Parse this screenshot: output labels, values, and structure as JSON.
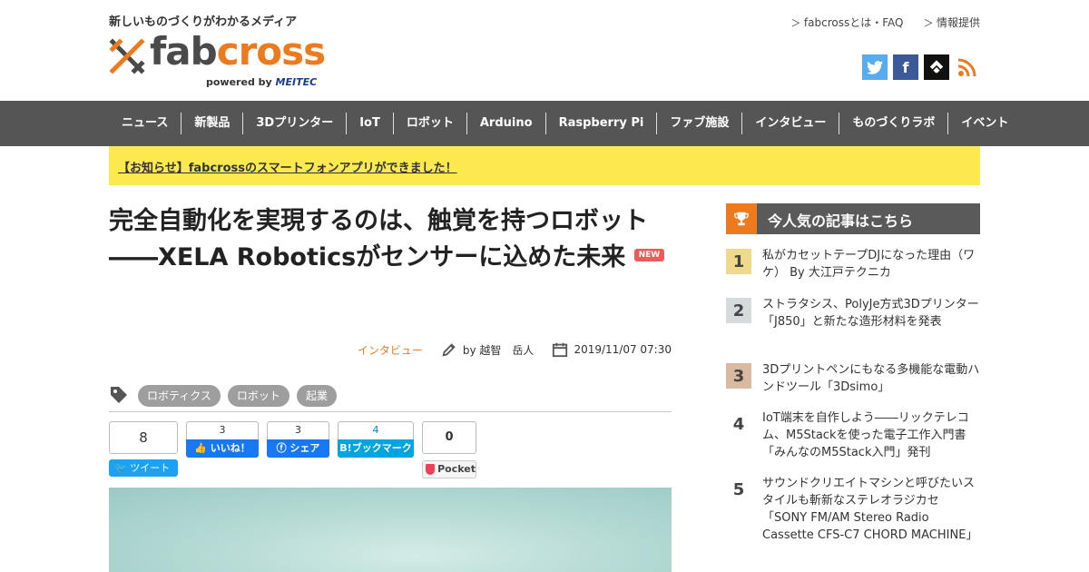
{
  "header": {
    "tagline": "新しいものづくりがわかるメディア",
    "logo": {
      "fab": "fab",
      "cross": "cross",
      "powered_by": "powered by",
      "meitec": "MEITEC"
    },
    "links": [
      "fabcrossとは・FAQ",
      "情報提供"
    ],
    "social": [
      {
        "name": "twitter-icon",
        "glyph": ""
      },
      {
        "name": "facebook-icon",
        "glyph": "f"
      },
      {
        "name": "feedly-icon",
        "glyph": ""
      },
      {
        "name": "rss-icon",
        "glyph": ""
      }
    ]
  },
  "nav": [
    "ニュース",
    "新製品",
    "3Dプリンター",
    "IoT",
    "ロボット",
    "Arduino",
    "Raspberry Pi",
    "ファブ施設",
    "インタビュー",
    "ものづくりラボ",
    "イベント"
  ],
  "notice": "【お知らせ】fabcrossのスマートフォンアプリができました！",
  "article": {
    "title": "完全自動化を実現するのは、触覚を持つロボット――XELA Roboticsがセンサーに込めた未来",
    "new_badge": "NEW",
    "category": "インタビュー",
    "author": "by 越智　岳人",
    "date": "2019/11/07 07:30",
    "tags": [
      "ロボティクス",
      "ロボット",
      "起業"
    ]
  },
  "share": {
    "tweet": {
      "count": "8",
      "label": "ツイート"
    },
    "like": {
      "count": "3",
      "label": "いいね！"
    },
    "fb_share": {
      "count": "3",
      "label": "シェア"
    },
    "hatena": {
      "count": "4",
      "label": "B!ブックマーク"
    },
    "pocket": {
      "count": "0",
      "label": "Pocket"
    }
  },
  "sidebar": {
    "heading": "今人気の記事はこちら",
    "ranking": [
      {
        "rank": "1",
        "title": "私がカセットテープDJになった理由（ワケ） By 大江戸テクニカ",
        "color": "#efd98a"
      },
      {
        "rank": "2",
        "title": "ストラタシス、PolyJe方式3Dプリンター「J850」と新たな造形材料を発表",
        "color": "#d5dadd"
      },
      {
        "rank": "3",
        "title": "3Dプリントペンにもなる多機能な電動ハンドツール「3Dsimo」",
        "color": "#d9b9a0"
      },
      {
        "rank": "4",
        "title": "IoT端末を自作しよう――リックテレコム、M5Stackを使った電子工作入門書「みんなのM5Stack入門」発刊",
        "color": "#ffffff"
      },
      {
        "rank": "5",
        "title": "サウンドクリエイトマシンと呼びたいスタイルも斬新なステレオラジカセ「SONY FM/AM Stereo Radio Cassette CFS-C7 CHORD MACHINE」",
        "color": "#ffffff"
      }
    ]
  },
  "colors": {
    "brand_orange": "#ee7a1e",
    "nav_bg": "#555555",
    "notice_bg": "#fce94f"
  }
}
